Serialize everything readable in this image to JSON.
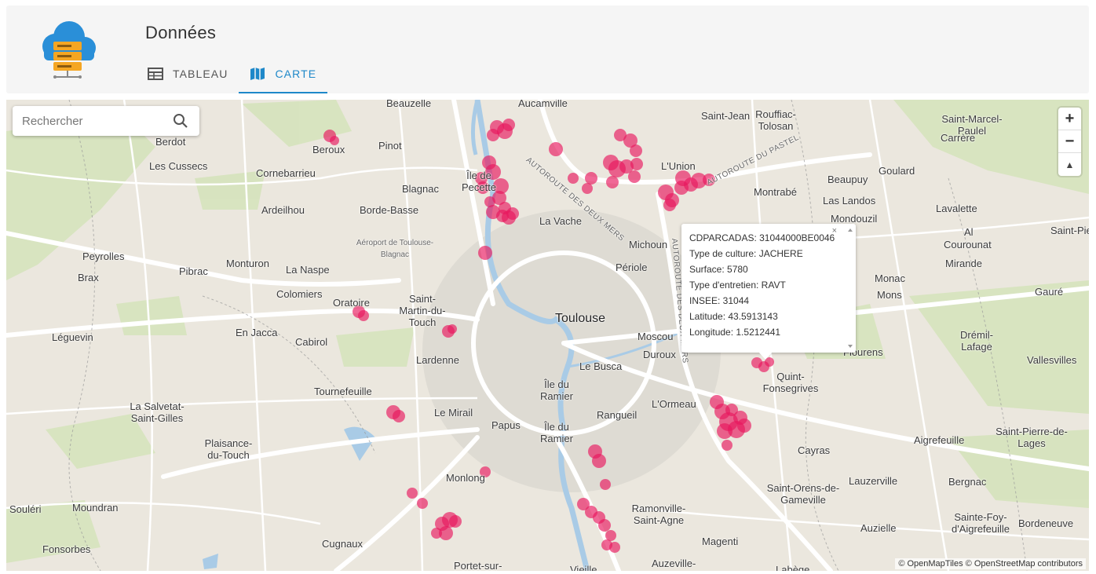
{
  "header": {
    "title": "Données",
    "tabs": [
      {
        "label": "TABLEAU",
        "icon": "table-icon",
        "active": false
      },
      {
        "label": "CARTE",
        "icon": "map-icon",
        "active": true
      }
    ],
    "accent_color": "#1e88c9"
  },
  "map": {
    "search": {
      "placeholder": "Rechercher",
      "icon": "search-icon"
    },
    "zoom_controls": {
      "zoom_in": "+",
      "zoom_out": "−",
      "compass": "▲"
    },
    "attribution": "© OpenMapTiles © OpenStreetMap contributors",
    "marker_color": "#e8175d",
    "places": [
      "Beauzelle",
      "Aucamville",
      "Saint-Jean",
      "Rouffiac-Tolosan",
      "Saint-Marcel-Paulel",
      "Berdot",
      "Beroux",
      "Pinot",
      "Carrère",
      "Les Cussecs",
      "Cornebarrieu",
      "Île de Pecette",
      "L'Union",
      "Goulard",
      "Blagnac",
      "Montrabé",
      "Beaupuy",
      "Ardeilhou",
      "Borde-Basse",
      "Las Landos",
      "Lavalette",
      "La Vache",
      "Mondouzil",
      "Al",
      "Saint-Pierre",
      "Aéroport de Toulouse-Blagnac",
      "Michoun",
      "Courounat",
      "Peyrolles",
      "Monturon",
      "Mirande",
      "Brax",
      "Pibrac",
      "La Naspe",
      "Périole",
      "Monac",
      "Colomiers",
      "Oratoire",
      "Saint-Martin-du-Touch",
      "Mons",
      "Gauré",
      "Toulouse",
      "Léguevin",
      "En Jacca",
      "Moscou",
      "Cabirol",
      "Lardenne",
      "Duroux",
      "Flourens",
      "Drémil-Lafage",
      "Le Busca",
      "Vallesvilles",
      "Quint-Fonsegrives",
      "Tournefeuille",
      "Île du Ramier",
      "L'Ormeau",
      "La Salvetat-Saint-Gilles",
      "Le Mirail",
      "Papus",
      "Île du Ramier",
      "Rangueil",
      "Aigrefeuille",
      "Saint-Pierre-de-Lages",
      "Plaisance-du-Touch",
      "Cayras",
      "Monlong",
      "Lauzerville",
      "Bergnac",
      "Saint-Orens-de-Gameville",
      "Souléri",
      "Moundran",
      "Ramonville-Saint-Agne",
      "Auzielle",
      "Sainte-Foy-d'Aigrefeuille",
      "Bordeneuve",
      "Fonsorbes",
      "Cugnaux",
      "Magenti",
      "Portet-sur-",
      "Auzeville-",
      "Vieille",
      "Labège",
      "AUTOROUTE DES DEUX MERS",
      "AUTOROUTE DU PASTEL",
      "AUTOROUTE DES DEUX MERS"
    ],
    "popup": {
      "close": "×",
      "lines": [
        "CDPARCADAS: 31044000BE0046",
        "Type de culture: JACHERE",
        "Surface: 5780",
        "Type d'entretien: RAVT",
        "INSEE: 31044",
        "Latitude: 43.5913143",
        "Longitude: 1.5212441"
      ]
    }
  }
}
